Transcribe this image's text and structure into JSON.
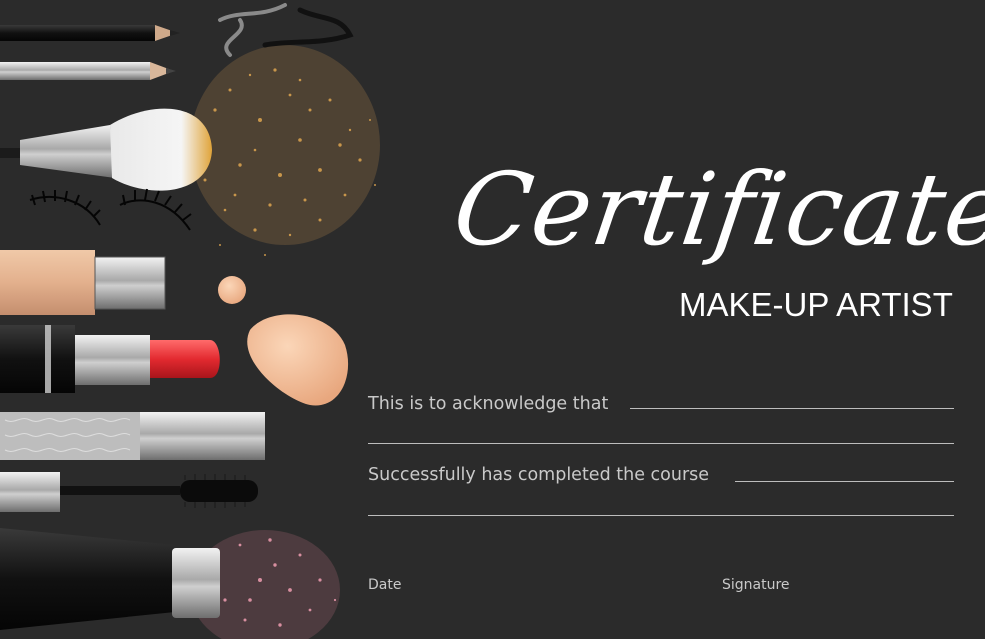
{
  "certificate": {
    "title": "Certificate",
    "subtitle": "MAKE-UP ARTIST",
    "acknowledge_text": "This is to acknowledge that",
    "completed_text": "Successfully has completed the course",
    "date_label": "Date",
    "signature_label": "Signature"
  },
  "colors": {
    "background": "#2b2b2b",
    "text": "#ffffff",
    "muted_text": "#c9c9c9",
    "lipstick": "#e8363b",
    "foundation": "#f2c4a3",
    "gold_glitter": "#d6a04e",
    "pink_glitter": "#d88fa0"
  },
  "icons": [
    "eyeliner-pencil-icon",
    "brow-pencil-icon",
    "makeup-brush-icon",
    "false-eyelashes-icon",
    "foundation-tube-icon",
    "lipstick-icon",
    "mascara-icon",
    "concealer-tube-icon",
    "glitter-gold-icon",
    "glitter-pink-icon",
    "foundation-drop-icon"
  ]
}
